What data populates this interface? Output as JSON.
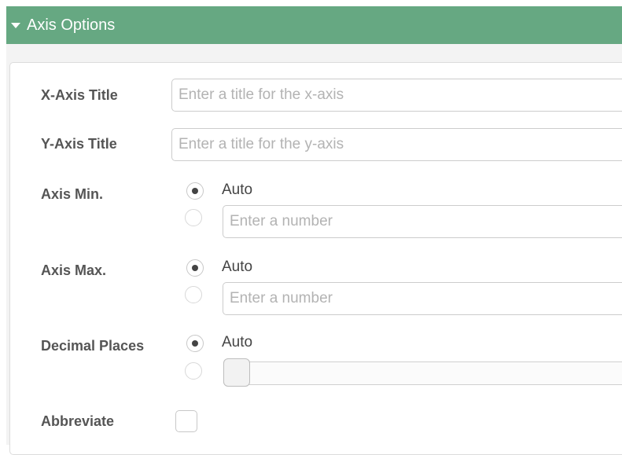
{
  "header": {
    "title": "Axis Options",
    "expanded": true,
    "color": "#66a882"
  },
  "form": {
    "x_axis_title": {
      "label": "X-Axis Title",
      "value": "",
      "placeholder": "Enter a title for the x-axis"
    },
    "y_axis_title": {
      "label": "Y-Axis Title",
      "value": "",
      "placeholder": "Enter a title for the y-axis"
    },
    "axis_min": {
      "label": "Axis Min.",
      "selected": "auto",
      "auto_label": "Auto",
      "number_placeholder": "Enter a number"
    },
    "axis_max": {
      "label": "Axis Max.",
      "selected": "auto",
      "auto_label": "Auto",
      "number_placeholder": "Enter a number"
    },
    "decimal_places": {
      "label": "Decimal Places",
      "selected": "auto",
      "auto_label": "Auto",
      "slider_value": 0
    },
    "abbreviate": {
      "label": "Abbreviate",
      "checked": false
    }
  }
}
